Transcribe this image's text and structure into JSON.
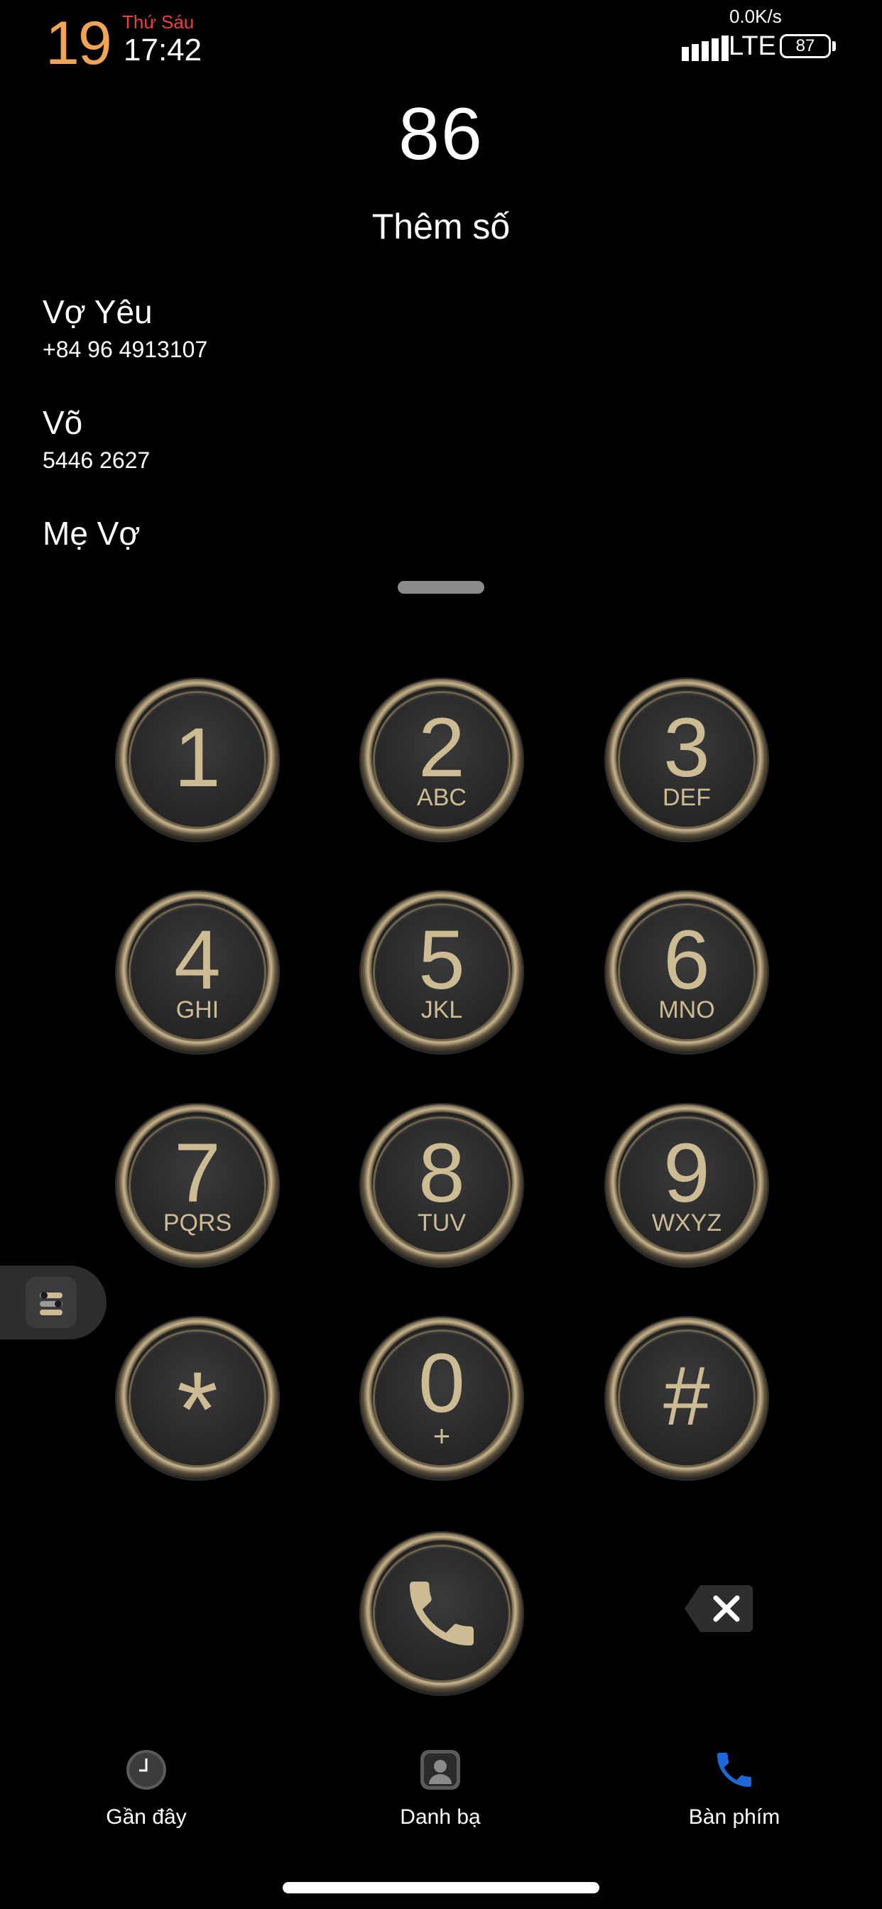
{
  "status_bar": {
    "date_number": "19",
    "weekday": "Thứ Sáu",
    "time": "17:42",
    "net_speed": "0.0K/s",
    "network": "LTE",
    "battery": "87"
  },
  "dialer": {
    "dialed_number": "86",
    "add_number_label": "Thêm số"
  },
  "suggestions": [
    {
      "name": "Vợ Yêu",
      "number": "+84 96 4913107"
    },
    {
      "name": "Võ",
      "number": "5446 2627"
    },
    {
      "name": "Mẹ Vợ",
      "number": ""
    }
  ],
  "keypad": [
    {
      "digit": "1",
      "letters": ""
    },
    {
      "digit": "2",
      "letters": "ABC"
    },
    {
      "digit": "3",
      "letters": "DEF"
    },
    {
      "digit": "4",
      "letters": "GHI"
    },
    {
      "digit": "5",
      "letters": "JKL"
    },
    {
      "digit": "6",
      "letters": "MNO"
    },
    {
      "digit": "7",
      "letters": "PQRS"
    },
    {
      "digit": "8",
      "letters": "TUV"
    },
    {
      "digit": "9",
      "letters": "WXYZ"
    },
    {
      "digit": "*",
      "letters": ""
    },
    {
      "digit": "0",
      "letters": "+"
    },
    {
      "digit": "#",
      "letters": ""
    }
  ],
  "bottom_nav": [
    {
      "label": "Gần đây",
      "icon": "clock-icon"
    },
    {
      "label": "Danh bạ",
      "icon": "contacts-icon"
    },
    {
      "label": "Bàn phím",
      "icon": "phone-keypad-icon",
      "active": true
    }
  ],
  "colors": {
    "accent_date": "#f0a455",
    "weekday_red": "#e8423b",
    "key_gold": "#cdbb93",
    "active_nav_blue": "#1f66d6"
  }
}
